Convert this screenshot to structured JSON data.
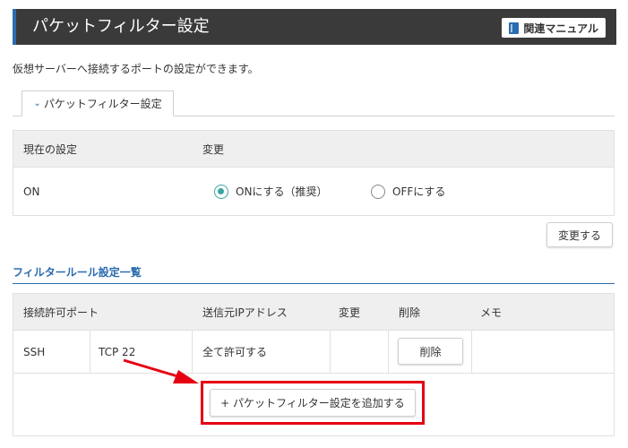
{
  "header": {
    "title": "パケットフィルター設定",
    "manual_label": "関連マニュアル"
  },
  "description": "仮想サーバーへ接続するポートの設定ができます。",
  "tab": {
    "label": "パケットフィルター設定"
  },
  "current_setting": {
    "col_current": "現在の設定",
    "col_change": "変更",
    "value": "ON",
    "option_on": "ONにする（推奨）",
    "option_off": "OFFにする",
    "selected": "on",
    "submit_label": "変更する"
  },
  "rules": {
    "section_title": "フィルタールール設定一覧",
    "headers": {
      "port": "接続許可ポート",
      "source": "送信元IPアドレス",
      "change": "変更",
      "delete": "削除",
      "memo": "メモ"
    },
    "rows": [
      {
        "name": "SSH",
        "port": "TCP 22",
        "source": "全て許可する",
        "delete_label": "削除",
        "memo": ""
      }
    ],
    "add_label": "+ パケットフィルター設定を追加する"
  },
  "colors": {
    "accent": "#2b6cb0",
    "highlight": "#e60012",
    "header_bg": "#3a3a3a",
    "radio": "#3aa6a0"
  }
}
